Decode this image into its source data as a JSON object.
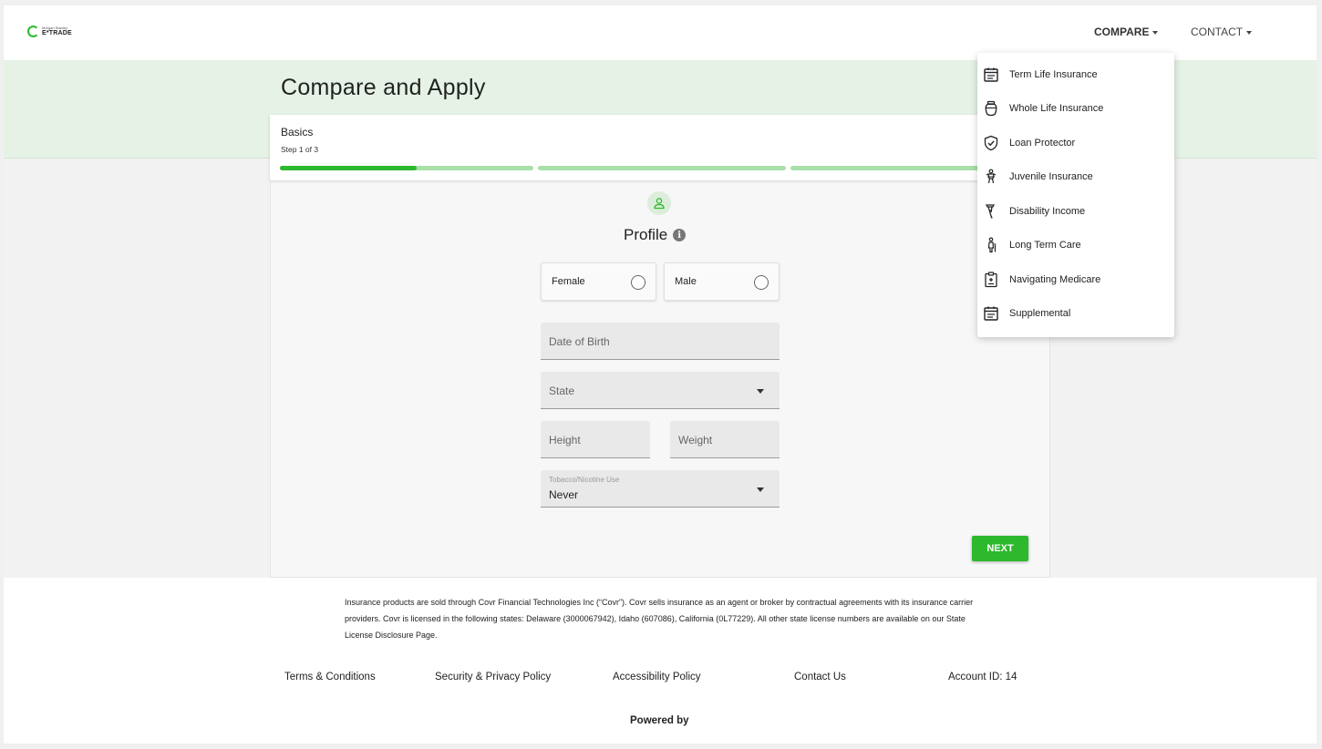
{
  "header": {
    "logo_small_text": "Morgan Stanley",
    "logo_text": "E*TRADE",
    "nav": {
      "compare": "COMPARE",
      "contact": "CONTACT"
    }
  },
  "page": {
    "title": "Compare and Apply"
  },
  "steps": {
    "title": "Basics",
    "subtitle": "Step 1 of 3",
    "progress": [
      0.54,
      0,
      0
    ]
  },
  "profile": {
    "title": "Profile",
    "info_icon": "i",
    "gender_options": [
      "Female",
      "Male"
    ],
    "dob_placeholder": "Date of Birth",
    "state_placeholder": "State",
    "height_placeholder": "Height",
    "weight_placeholder": "Weight",
    "tobacco": {
      "label": "Tobacco/Nicotine Use",
      "value": "Never"
    },
    "next_label": "NEXT"
  },
  "compare_menu": {
    "items": [
      {
        "label": "Term Life Insurance",
        "icon": "calendar-list-icon"
      },
      {
        "label": "Whole Life Insurance",
        "icon": "jar-icon"
      },
      {
        "label": "Loan Protector",
        "icon": "shield-check-icon"
      },
      {
        "label": "Juvenile Insurance",
        "icon": "child-icon"
      },
      {
        "label": "Disability Income",
        "icon": "crutch-icon"
      },
      {
        "label": "Long Term Care",
        "icon": "cane-person-icon"
      },
      {
        "label": "Navigating Medicare",
        "icon": "clipboard-icon"
      },
      {
        "label": "Supplemental",
        "icon": "calendar-list-icon"
      }
    ]
  },
  "footer": {
    "disclaimer_text": "Insurance products are sold through Covr Financial Technologies Inc (“Covr”). Covr sells insurance as an agent or broker by contractual agreements with its insurance carrier providers. Covr is licensed in the following states: Delaware (3000067942), Idaho (607086), California (0L77229). All other state license numbers are available on our ",
    "disclaimer_link": "State License Disclosure Page",
    "disclaimer_end": ".",
    "links": [
      "Terms & Conditions",
      "Security & Privacy Policy",
      "Accessibility Policy",
      "Contact Us"
    ],
    "account_id": "Account ID: 14",
    "powered_by": "Powered by"
  },
  "colors": {
    "accent": "#2db82d",
    "band": "#e5f2e5",
    "progress_light": "#a9dfa9"
  }
}
